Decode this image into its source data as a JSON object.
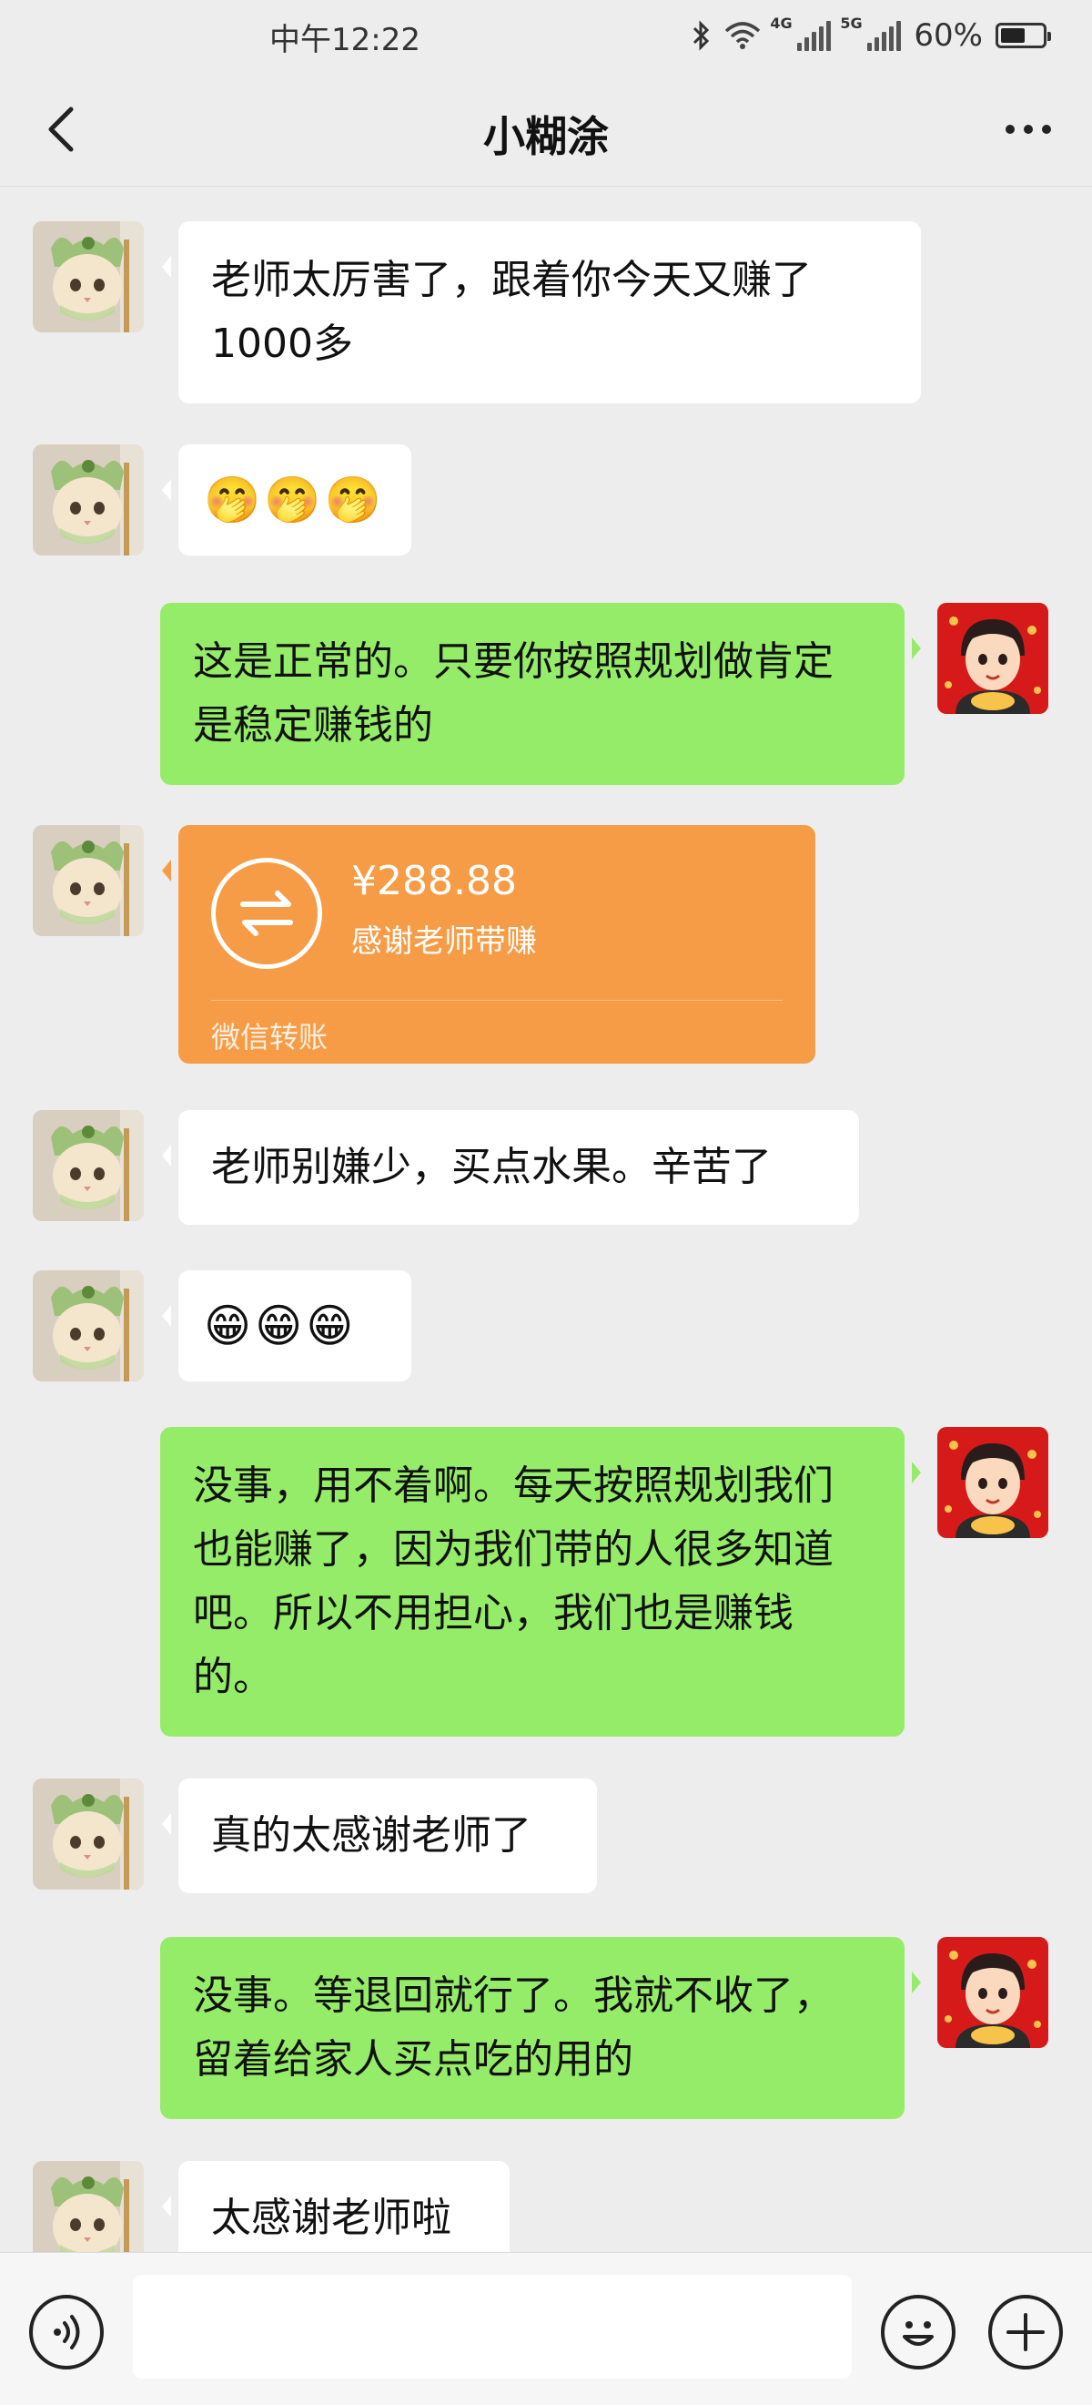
{
  "status_bar": {
    "time": "中午12:22",
    "network_1": "4G",
    "network_2": "5G",
    "battery_text": "60%",
    "battery_level": 0.6,
    "icons": [
      "bluetooth-icon",
      "wifi-icon",
      "signal-icon",
      "battery-icon"
    ]
  },
  "nav": {
    "title": "小糊涂",
    "back_icon": "chevron-left-icon",
    "more_icon": "more-dots-icon"
  },
  "messages": [
    {
      "side": "left",
      "type": "text",
      "text": "老师太厉害了，跟着你今天又赚了1000多"
    },
    {
      "side": "left",
      "type": "emoji",
      "text": "🤭🤭🤭"
    },
    {
      "side": "right",
      "type": "text",
      "text": "这是正常的。只要你按照规划做肯定是稳定赚钱的"
    },
    {
      "side": "left",
      "type": "transfer",
      "amount": "¥288.88",
      "note": "感谢老师带赚",
      "footer": "微信转账"
    },
    {
      "side": "left",
      "type": "text",
      "text": "老师别嫌少，买点水果。辛苦了"
    },
    {
      "side": "left",
      "type": "emoji",
      "text": "😁😁😁"
    },
    {
      "side": "right",
      "type": "text",
      "text": "没事，用不着啊。每天按照规划我们也能赚了，因为我们带的人很多知道吧。所以不用担心，我们也是赚钱的。"
    },
    {
      "side": "left",
      "type": "text",
      "text": "真的太感谢老师了"
    },
    {
      "side": "right",
      "type": "text",
      "text": "没事。等退回就行了。我就不收了，留着给家人买点吃的用的"
    },
    {
      "side": "left",
      "type": "text",
      "text": "太感谢老师啦"
    }
  ],
  "input_bar": {
    "placeholder": "",
    "voice_icon": "voice-icon",
    "emoji_icon": "smiley-icon",
    "plus_icon": "plus-icon"
  },
  "colors": {
    "background": "#ededed",
    "self_bubble": "#95ec69",
    "other_bubble": "#ffffff",
    "transfer_card": "#f79c46"
  }
}
